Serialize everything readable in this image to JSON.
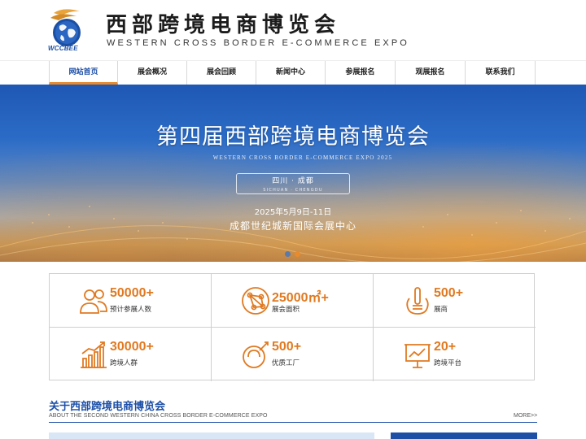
{
  "header": {
    "logo_caption": "WCCBEE",
    "title": "西部跨境电商博览会",
    "subtitle": "WESTERN CROSS BORDER E-COMMERCE EXPO"
  },
  "nav": {
    "items": [
      {
        "label": "网站首页",
        "active": true
      },
      {
        "label": "展会概况",
        "active": false
      },
      {
        "label": "展会回顾",
        "active": false
      },
      {
        "label": "新闻中心",
        "active": false
      },
      {
        "label": "参展报名",
        "active": false
      },
      {
        "label": "观展报名",
        "active": false
      },
      {
        "label": "联系我们",
        "active": false
      }
    ]
  },
  "banner": {
    "title": "第四届西部跨境电商博览会",
    "subtitle": "WESTERN CROSS BORDER E-COMMERCE EXPO 2025",
    "badge_main": "四川 · 成都",
    "badge_sub": "SICHUAN · CHENGDU",
    "date": "2025年5月9日-11日",
    "venue": "成都世纪城新国际会展中心",
    "active_slide": 2,
    "slide_count": 2
  },
  "stats": [
    {
      "value": "50000+",
      "label": "预计参展人数",
      "icon": "people-icon"
    },
    {
      "value": "25000㎡+",
      "label": "展会面积",
      "icon": "network-icon"
    },
    {
      "value": "500+",
      "label": "展商",
      "icon": "touch-icon"
    },
    {
      "value": "30000+",
      "label": "跨境人群",
      "icon": "growth-chart-icon"
    },
    {
      "value": "500+",
      "label": "优质工厂",
      "icon": "magnet-icon"
    },
    {
      "value": "20+",
      "label": "跨境平台",
      "icon": "presentation-icon"
    }
  ],
  "about": {
    "title": "关于西部跨境电商博览会",
    "subtitle": "ABOUT THE SECOND WESTERN CHINA CROSS BORDER E-COMMERCE EXPO",
    "more": "MORE>>"
  },
  "colors": {
    "brand_blue": "#1d4fa7",
    "accent_orange": "#e07a22"
  }
}
